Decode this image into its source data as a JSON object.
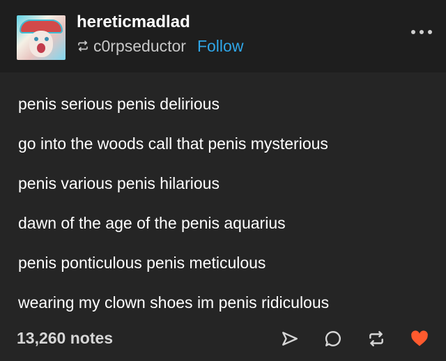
{
  "header": {
    "blog_name": "hereticmadlad",
    "reblogged_from": "c0rpseductor",
    "follow_label": "Follow",
    "avatar_icon": "avatar-image",
    "reblog_icon": "reblog-icon",
    "more_icon": "ellipsis-icon"
  },
  "post": {
    "lines": [
      "penis serious penis delirious",
      "go into the woods call that penis mysterious",
      "penis various penis hilarious",
      "dawn of the age of the penis aquarius",
      "penis ponticulous penis meticulous",
      "wearing my clown shoes im penis ridiculous"
    ]
  },
  "footer": {
    "notes": "13,260 notes",
    "actions": [
      "share-icon",
      "reply-icon",
      "reblog-icon",
      "like-icon"
    ]
  },
  "colors": {
    "background": "#252525",
    "header_background": "#1e1e1e",
    "follow": "#2fa6e8",
    "like": "#ff5a2e"
  }
}
